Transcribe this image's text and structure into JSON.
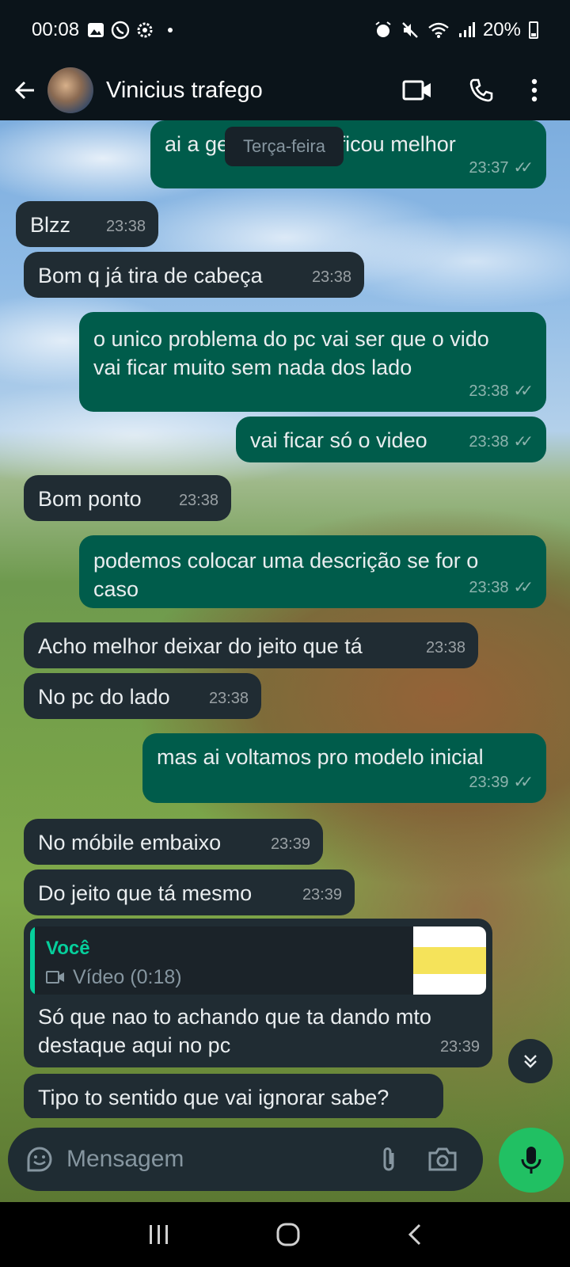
{
  "status_bar": {
    "time": "00:08",
    "battery": "20%",
    "left_icons": [
      "gallery-icon",
      "whatsapp-icon",
      "settings-icon",
      "dot-icon"
    ],
    "right_icons": [
      "alarm-icon",
      "mute-icon",
      "wifi-icon",
      "signal-icon",
      "battery-icon"
    ]
  },
  "header": {
    "contact_name": "Vinicius trafego",
    "actions": [
      "video-call-icon",
      "phone-call-icon",
      "more-options-icon"
    ]
  },
  "date_chip": "Terça-feira",
  "colors": {
    "incoming_bubble": "#202c33",
    "outgoing_bubble": "#005c4b",
    "reply_accent": "#06cf9c",
    "mic_button": "#21c063",
    "app_bar": "#0b141a"
  },
  "messages": [
    {
      "direction": "out",
      "text": "ai a gente ve qual ficou melhor",
      "time": "23:37",
      "ticks": "read"
    },
    {
      "direction": "in",
      "text": "Blzz",
      "time": "23:38"
    },
    {
      "direction": "in",
      "text": "Bom q já tira de cabeça",
      "time": "23:38"
    },
    {
      "direction": "out",
      "text": "o unico problema do pc vai ser que o vido vai ficar muito sem nada dos lado",
      "time": "23:38",
      "ticks": "read"
    },
    {
      "direction": "out",
      "text": "vai ficar só o video",
      "time": "23:38",
      "ticks": "read"
    },
    {
      "direction": "in",
      "text": "Bom ponto",
      "time": "23:38"
    },
    {
      "direction": "out",
      "text": "podemos colocar uma descrição se for o caso",
      "time": "23:38",
      "ticks": "read"
    },
    {
      "direction": "in",
      "text": "Acho melhor deixar do jeito que tá",
      "time": "23:38"
    },
    {
      "direction": "in",
      "text": "No pc do lado",
      "time": "23:38"
    },
    {
      "direction": "out",
      "text": "mas ai voltamos pro modelo inicial",
      "time": "23:39",
      "ticks": "read"
    },
    {
      "direction": "in",
      "text": "No móbile embaixo",
      "time": "23:39"
    },
    {
      "direction": "in",
      "text": "Do jeito que tá mesmo",
      "time": "23:39"
    },
    {
      "direction": "in",
      "text": "Só que nao to achando que ta dando mto destaque aqui no pc",
      "time": "23:39",
      "reply": {
        "author": "Você",
        "label": "Vídeo (0:18)",
        "icon": "video-icon"
      }
    },
    {
      "direction": "in",
      "text": "Tipo to sentido que vai ignorar sabe?",
      "time": ""
    }
  ],
  "composer": {
    "placeholder": "Mensagem",
    "icons": [
      "sticker-icon",
      "attach-icon",
      "camera-icon",
      "mic-icon"
    ]
  },
  "nav_bar": [
    "recents-icon",
    "home-icon",
    "back-nav-icon"
  ]
}
